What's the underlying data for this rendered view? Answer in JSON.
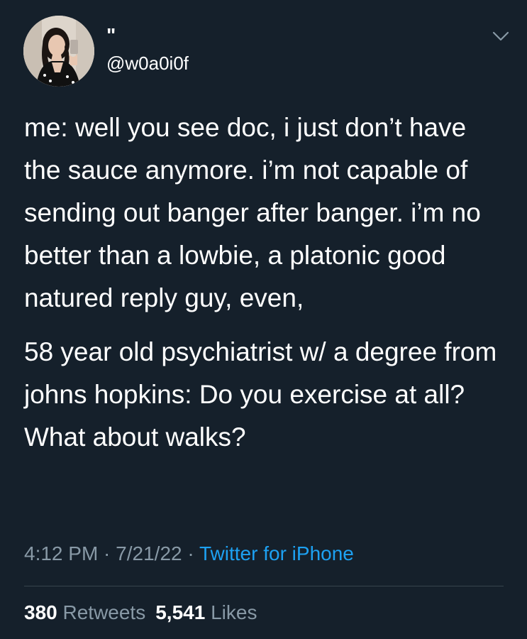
{
  "tweet": {
    "display_name": "\"",
    "handle": "@w0a0i0f",
    "body": [
      "me: well you see doc, i just don’t have the sauce anymore. i’m not capable of sending out banger after banger. i’m no better than a lowbie, a platonic good natured reply guy, even,",
      "58 year old psychiatrist w/ a degree from johns hopkins: Do you exercise at all? What about walks?"
    ],
    "time": "4:12 PM",
    "sep1": " · ",
    "date": "7/21/22",
    "sep2": " · ",
    "source": "Twitter for iPhone",
    "retweets_count": "380",
    "retweets_label": " Retweets",
    "likes_count": "5,541",
    "likes_label": " Likes"
  },
  "icons": {
    "menu": "chevron-down-icon",
    "avatar": "profile-photo"
  },
  "colors": {
    "background": "#15202b",
    "text": "#ffffff",
    "secondary": "#8899a6",
    "link": "#1da1f2",
    "divider": "#38444d"
  }
}
